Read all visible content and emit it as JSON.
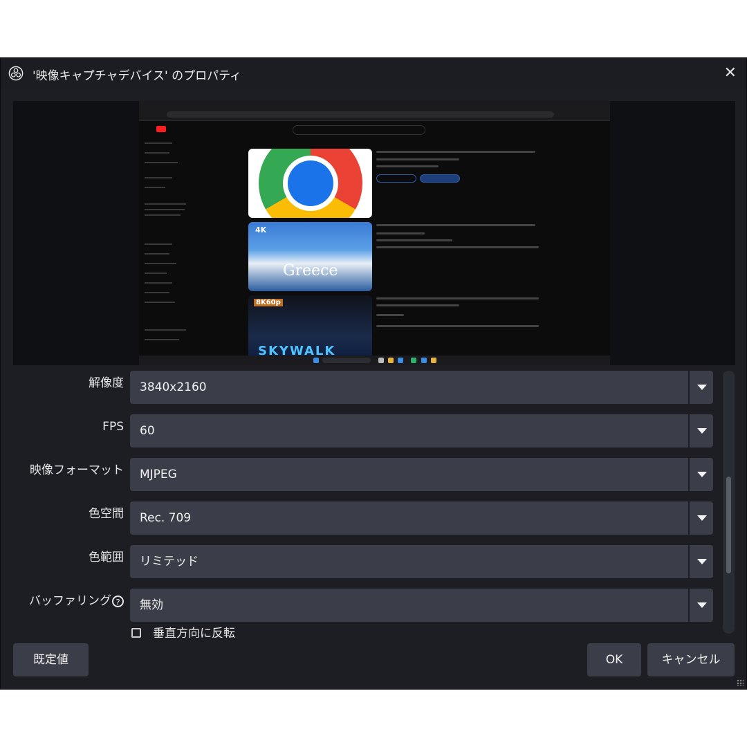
{
  "window": {
    "title": "'映像キャプチャデバイス' のプロパティ",
    "close_glyph": "✕",
    "logo_icon": "obs-logo-icon"
  },
  "preview": {
    "captured_labels": {
      "thumb2_badge": "4K",
      "thumb2_text": "Greece",
      "thumb3_badge": "8K60p",
      "thumb3_text": "SKYWALK"
    }
  },
  "settings": [
    {
      "id": "resolution",
      "label": "解像度",
      "value": "3840x2160"
    },
    {
      "id": "fps",
      "label": "FPS",
      "value": "60"
    },
    {
      "id": "video-format",
      "label": "映像フォーマット",
      "value": "MJPEG"
    },
    {
      "id": "color-space",
      "label": "色空間",
      "value": "Rec. 709"
    },
    {
      "id": "color-range",
      "label": "色範囲",
      "value": "リミテッド"
    },
    {
      "id": "buffering",
      "label": "バッファリング",
      "value": "無効",
      "help": "?"
    }
  ],
  "checkbox": {
    "label": "垂直方向に反転",
    "checked": false
  },
  "buttons": {
    "defaults": "既定値",
    "ok": "OK",
    "cancel": "キャンセル"
  },
  "colors": {
    "window_bg": "#1d1e24",
    "control_bg": "#3b3e48",
    "text": "#e6e6e6"
  }
}
